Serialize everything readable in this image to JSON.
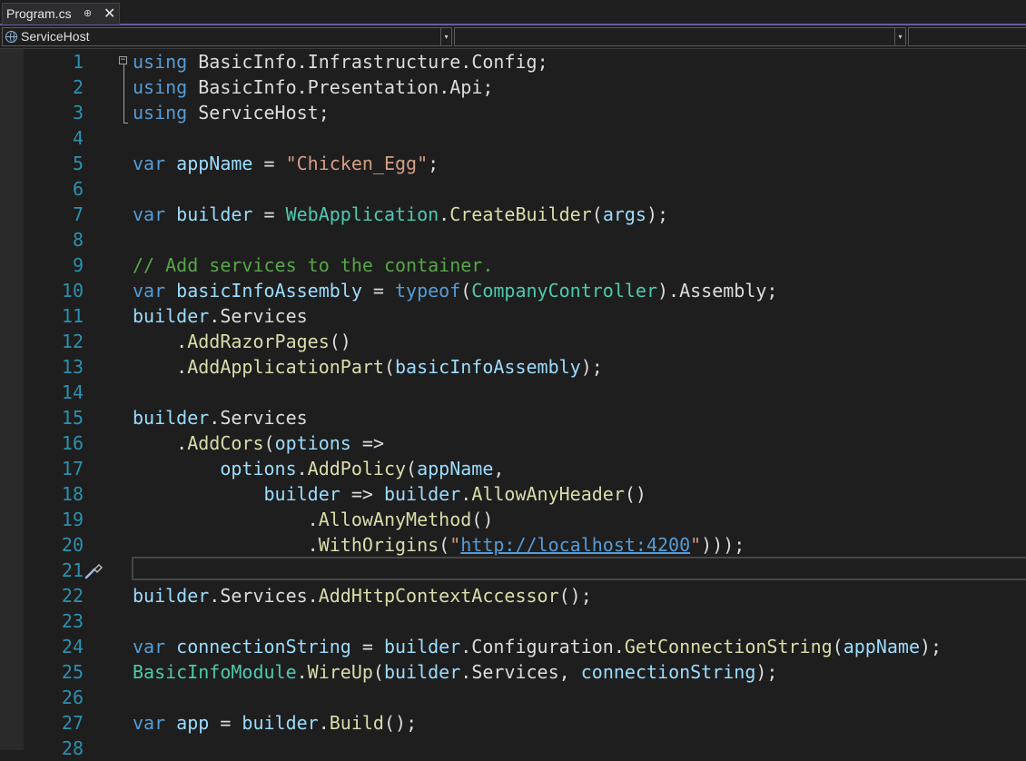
{
  "tab": {
    "title": "Program.cs",
    "pin_glyph": "⊕",
    "close_glyph": "✕"
  },
  "navbar": {
    "project": "ServiceHost",
    "type_member": "",
    "extra": ""
  },
  "editor": {
    "line_numbers": [
      "1",
      "2",
      "3",
      "4",
      "5",
      "6",
      "7",
      "8",
      "9",
      "10",
      "11",
      "12",
      "13",
      "14",
      "15",
      "16",
      "17",
      "18",
      "19",
      "20",
      "21",
      "22",
      "23",
      "24",
      "25",
      "26",
      "27",
      "28"
    ],
    "tokens": {
      "using": "using",
      "var": "var",
      "typeof": "typeof",
      "basicinfo": "BasicInfo",
      "infrastructure": "Infrastructure",
      "config": "Config",
      "presentation": "Presentation",
      "api": "Api",
      "servicehost": "ServiceHost",
      "appname": "appName",
      "chicken_egg": "\"Chicken_Egg\"",
      "builder": "builder",
      "webapplication": "WebApplication",
      "createbuilder": "CreateBuilder",
      "args": "args",
      "comment": "// Add services to the container.",
      "basicinfoassembly": "basicInfoAssembly",
      "companycontroller": "CompanyController",
      "assembly": "Assembly",
      "services": "Services",
      "addrazorpages": "AddRazorPages",
      "addapplicationpart": "AddApplicationPart",
      "addcors": "AddCors",
      "options": "options",
      "addpolicy": "AddPolicy",
      "allowanyheader": "AllowAnyHeader",
      "allowanymethod": "AllowAnyMethod",
      "withorigins": "WithOrigins",
      "url": "http://localhost:4200",
      "addhttpcontextaccessor": "AddHttpContextAccessor",
      "connectionstring": "connectionString",
      "configuration": "Configuration",
      "getconnectionstring": "GetConnectionString",
      "basicinfomodule": "BasicInfoModule",
      "wireup": "WireUp",
      "app": "app",
      "build": "Build"
    },
    "colors": {
      "keyword": "#569cd6",
      "type": "#4ec9b0",
      "method": "#dcdcaa",
      "variable": "#9cdcfe",
      "string": "#d69d85",
      "comment": "#57a64a",
      "line_number": "#2b91af"
    }
  }
}
